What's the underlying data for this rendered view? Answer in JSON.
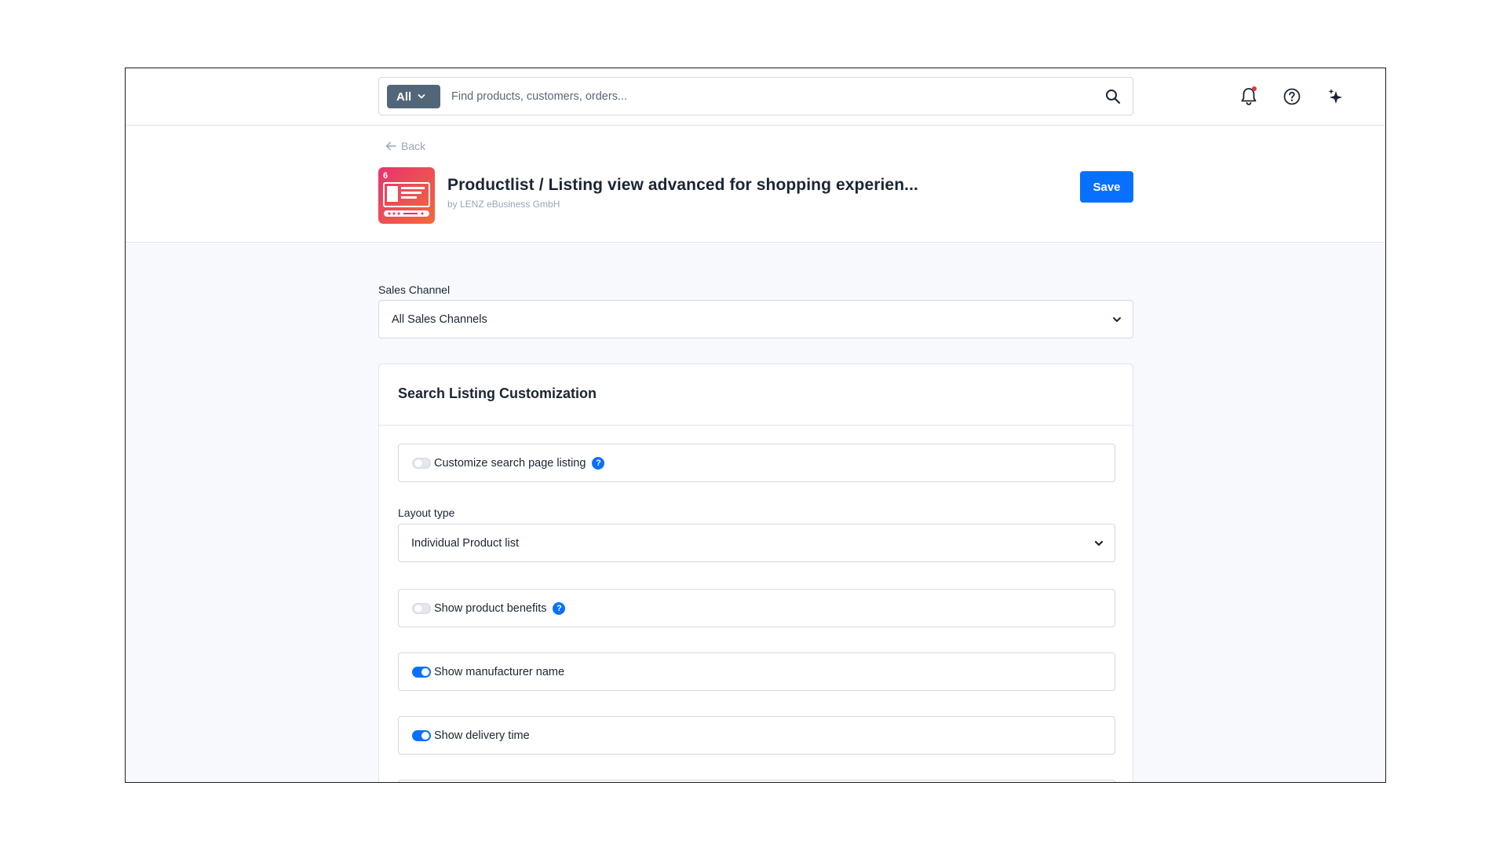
{
  "search": {
    "scope_label": "All",
    "placeholder": "Find products, customers, orders..."
  },
  "header": {
    "back_label": "Back",
    "app_title": "Productlist / Listing view advanced for shopping experien...",
    "app_vendor": "by LENZ eBusiness GmbH",
    "save_label": "Save"
  },
  "sales_channel": {
    "label": "Sales Channel",
    "value": "All Sales Channels"
  },
  "card": {
    "title": "Search Listing Customization",
    "customize_search": {
      "label": "Customize search page listing",
      "enabled": false,
      "help": "?"
    },
    "layout_type": {
      "label": "Layout type",
      "value": "Individual Product list"
    },
    "product_benefits": {
      "label": "Show product benefits",
      "enabled": false,
      "help": "?"
    },
    "manufacturer_name": {
      "label": "Show manufacturer name",
      "enabled": true
    },
    "delivery_time": {
      "label": "Show delivery time",
      "enabled": true
    }
  },
  "colors": {
    "primary": "#0870ff",
    "scope_button": "#52667a",
    "notification_dot": "#e3343b",
    "app_icon_gradient_start": "#e8336f",
    "app_icon_gradient_end": "#f26a3a"
  },
  "icons": {
    "search": "search-icon",
    "bell": "bell-icon",
    "help": "help-icon",
    "sparkle": "sparkle-icon",
    "back": "arrow-left-icon",
    "chevron": "chevron-down-icon"
  }
}
